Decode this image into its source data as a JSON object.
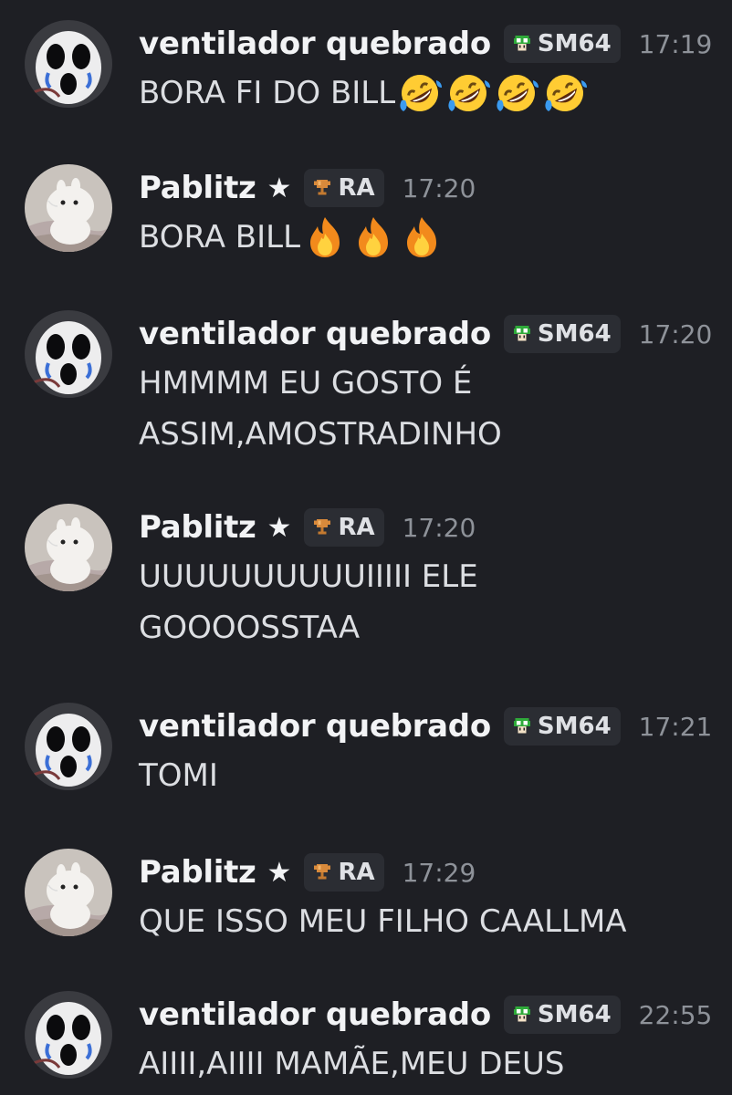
{
  "users": {
    "ventilador": {
      "name": "ventilador quebrado",
      "tag": "SM64",
      "tag_icon": "green-mushroom-icon",
      "avatar": "crying-face-avatar"
    },
    "pablitz": {
      "name": "Pablitz",
      "star": "★",
      "tag": "RA",
      "tag_icon": "trophy-icon",
      "avatar": "moomin-avatar"
    }
  },
  "messages": [
    {
      "user": "ventilador",
      "time": "17:19",
      "text": "BORA FI DO BILL",
      "emojis": [
        "rofl",
        "rofl",
        "rofl",
        "rofl"
      ]
    },
    {
      "user": "pablitz",
      "time": "17:20",
      "text": "BORA BILL",
      "emojis": [
        "fire",
        "fire",
        "fire"
      ]
    },
    {
      "user": "ventilador",
      "time": "17:20",
      "text": "HMMMM EU GOSTO É ASSIM,AMOSTRADINHO",
      "emojis": []
    },
    {
      "user": "pablitz",
      "time": "17:20",
      "text": "UUUUUUUUUUIIIII ELE GOOOOSSTAA",
      "emojis": []
    },
    {
      "user": "ventilador",
      "time": "17:21",
      "text": "TOMI",
      "emojis": []
    },
    {
      "user": "pablitz",
      "time": "17:29",
      "text": "QUE ISSO MEU FILHO CAALLMA",
      "emojis": []
    },
    {
      "user": "ventilador",
      "time": "22:55",
      "text": "AIIII,AIIII MAMÃE,MEU DEUS",
      "emojis": []
    }
  ],
  "colors": {
    "background": "#1e1f24",
    "username": "#f2f3f5",
    "timestamp": "#8e9299",
    "tag_bg": "#2b2d33"
  }
}
